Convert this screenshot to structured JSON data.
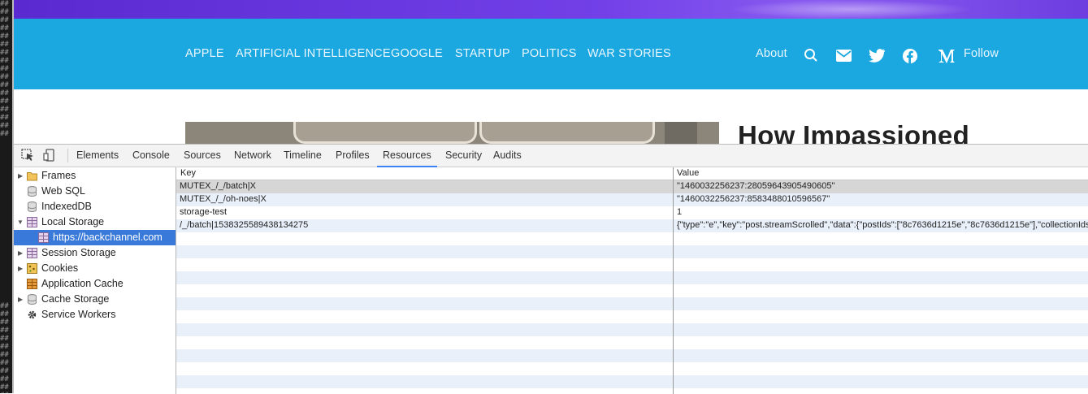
{
  "site": {
    "nav_items": [
      "APPLE",
      "ARTIFICIAL INTELLIGENCE",
      "GOOGLE",
      "STARTUP",
      "POLITICS",
      "WAR STORIES"
    ],
    "about": "About",
    "follow": "Follow",
    "headline": "How Impassioned",
    "icons": [
      "search-icon",
      "mail-icon",
      "twitter-icon",
      "facebook-icon",
      "medium-icon"
    ],
    "nav_bg": "#1ba7e0"
  },
  "devtools": {
    "tabs": [
      "Elements",
      "Console",
      "Sources",
      "Network",
      "Timeline",
      "Profiles",
      "Resources",
      "Security",
      "Audits"
    ],
    "active_tab": "Resources",
    "tree": [
      {
        "label": "Frames",
        "expand": "collapsed",
        "icon": "folder-icon"
      },
      {
        "label": "Web SQL",
        "expand": "none",
        "icon": "database-icon"
      },
      {
        "label": "IndexedDB",
        "expand": "none",
        "icon": "database-icon"
      },
      {
        "label": "Local Storage",
        "expand": "expanded",
        "icon": "storage-grid-icon"
      },
      {
        "label": "https://backchannel.com",
        "expand": "none",
        "icon": "storage-grid-icon",
        "selected": true
      },
      {
        "label": "Session Storage",
        "expand": "collapsed",
        "icon": "storage-grid-icon"
      },
      {
        "label": "Cookies",
        "expand": "collapsed",
        "icon": "cookie-icon"
      },
      {
        "label": "Application Cache",
        "expand": "none",
        "icon": "app-cache-icon"
      },
      {
        "label": "Cache Storage",
        "expand": "collapsed",
        "icon": "database-icon"
      },
      {
        "label": "Service Workers",
        "expand": "none",
        "icon": "gear-icon"
      }
    ],
    "grid": {
      "headers": [
        "Key",
        "Value"
      ],
      "rows": [
        {
          "key": "MUTEX_/_/batch|X",
          "value": "\"1460032256237:28059643905490605\""
        },
        {
          "key": "MUTEX_/_/oh-noes|X",
          "value": "\"1460032256237:8583488010596567\""
        },
        {
          "key": "storage-test",
          "value": "1"
        },
        {
          "key": "/_/batch|1538325589438134275",
          "value": "{\"type\":\"e\",\"key\":\"post.streamScrolled\",\"data\":{\"postIds\":[\"8c7636d1215e\",\"8c7636d1215e\"],\"collectionIds\""
        }
      ]
    }
  }
}
